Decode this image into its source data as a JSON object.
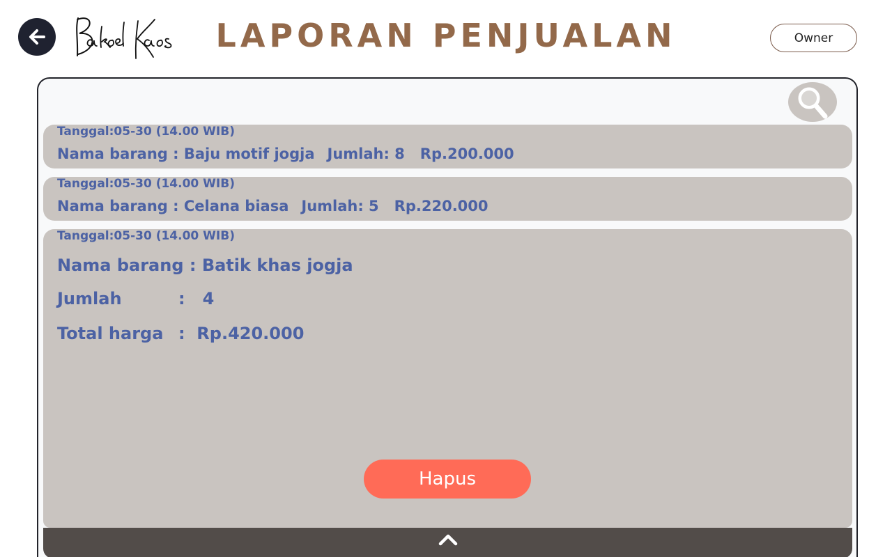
{
  "header": {
    "logo_text": "BakoelKaos",
    "title": "LAPORAN PENJUALAN",
    "role_button": "Owner"
  },
  "reports": [
    {
      "date": "Tanggal:05-30 (14.00 WIB)",
      "item": "Nama barang : Baju motif jogja",
      "qty": "Jumlah: 8",
      "price": "Rp.200.000"
    },
    {
      "date": "Tanggal:05-30 (14.00 WIB)",
      "item": "Nama barang : Celana biasa",
      "qty": "Jumlah: 5",
      "price": "Rp.220.000"
    }
  ],
  "expanded": {
    "date": "Tanggal:05-30 (14.00 WIB)",
    "item_label": "Nama barang : Batik khas jogja",
    "qty_label": "Jumlah",
    "qty_value": ":   4",
    "total_label": "Total harga",
    "total_value": ":  Rp.420.000",
    "delete_label": "Hapus"
  },
  "icons": {
    "back": "arrow-left-icon",
    "search": "search-icon",
    "collapse": "chevron-up-icon"
  }
}
